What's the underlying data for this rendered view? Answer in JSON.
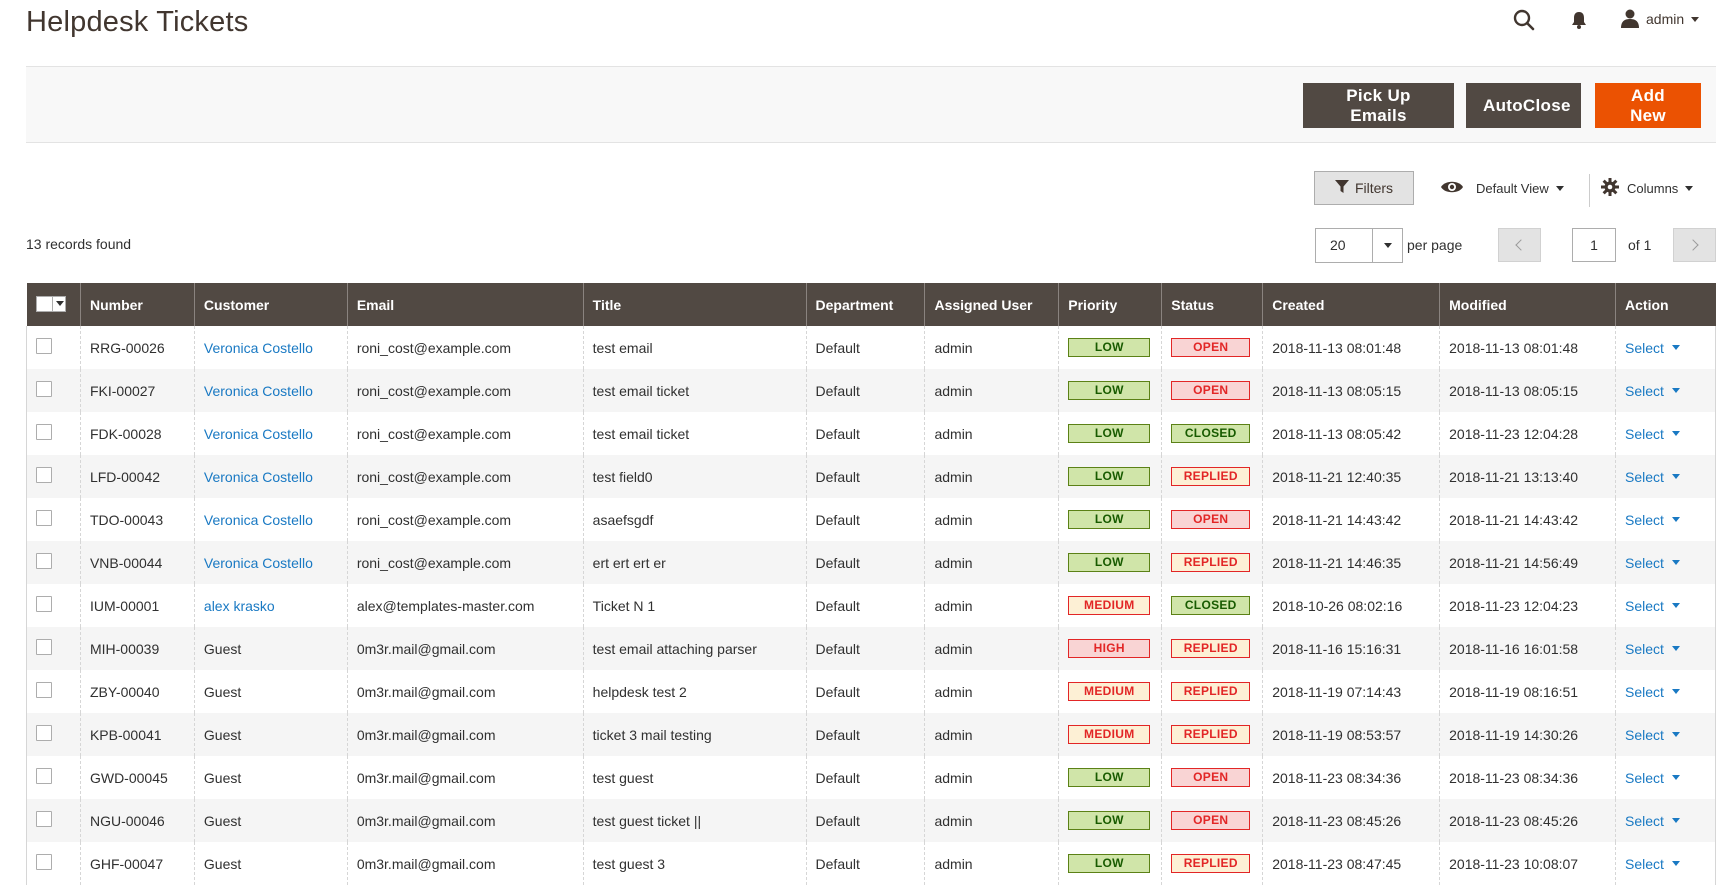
{
  "header": {
    "title": "Helpdesk Tickets",
    "user": "admin"
  },
  "actions": {
    "pick_up": "Pick Up Emails",
    "autoclose": "AutoClose",
    "add_new": "Add New"
  },
  "toolbar": {
    "filters": "Filters",
    "view": "Default View",
    "columns": "Columns"
  },
  "grid_info": {
    "records": "13 records found",
    "per_page_value": "20",
    "per_page_label": "per page",
    "page": "1",
    "of_pages": "of 1"
  },
  "columns": [
    "Number",
    "Customer",
    "Email",
    "Title",
    "Department",
    "Assigned User",
    "Priority",
    "Status",
    "Created",
    "Modified",
    "Action"
  ],
  "rows": [
    {
      "number": "RRG-00026",
      "customer": "Veronica Costello",
      "customer_link": true,
      "email": "roni_cost@example.com",
      "title": "test email",
      "department": "Default",
      "user": "admin",
      "priority": "LOW",
      "status": "OPEN",
      "created": "2018-11-13 08:01:48",
      "modified": "2018-11-13 08:01:48",
      "action": "Select"
    },
    {
      "number": "FKI-00027",
      "customer": "Veronica Costello",
      "customer_link": true,
      "email": "roni_cost@example.com",
      "title": "test email ticket",
      "department": "Default",
      "user": "admin",
      "priority": "LOW",
      "status": "OPEN",
      "created": "2018-11-13 08:05:15",
      "modified": "2018-11-13 08:05:15",
      "action": "Select"
    },
    {
      "number": "FDK-00028",
      "customer": "Veronica Costello",
      "customer_link": true,
      "email": "roni_cost@example.com",
      "title": "test email ticket",
      "department": "Default",
      "user": "admin",
      "priority": "LOW",
      "status": "CLOSED",
      "created": "2018-11-13 08:05:42",
      "modified": "2018-11-23 12:04:28",
      "action": "Select"
    },
    {
      "number": "LFD-00042",
      "customer": "Veronica Costello",
      "customer_link": true,
      "email": "roni_cost@example.com",
      "title": "test field0",
      "department": "Default",
      "user": "admin",
      "priority": "LOW",
      "status": "REPLIED",
      "created": "2018-11-21 12:40:35",
      "modified": "2018-11-21 13:13:40",
      "action": "Select"
    },
    {
      "number": "TDO-00043",
      "customer": "Veronica Costello",
      "customer_link": true,
      "email": "roni_cost@example.com",
      "title": "asaefsgdf",
      "department": "Default",
      "user": "admin",
      "priority": "LOW",
      "status": "OPEN",
      "created": "2018-11-21 14:43:42",
      "modified": "2018-11-21 14:43:42",
      "action": "Select"
    },
    {
      "number": "VNB-00044",
      "customer": "Veronica Costello",
      "customer_link": true,
      "email": "roni_cost@example.com",
      "title": "ert ert ert er",
      "department": "Default",
      "user": "admin",
      "priority": "LOW",
      "status": "REPLIED",
      "created": "2018-11-21 14:46:35",
      "modified": "2018-11-21 14:56:49",
      "action": "Select"
    },
    {
      "number": "IUM-00001",
      "customer": "alex krasko",
      "customer_link": true,
      "email": "alex@templates-master.com",
      "title": "Ticket N 1",
      "department": "Default",
      "user": "admin",
      "priority": "MEDIUM",
      "status": "CLOSED",
      "created": "2018-10-26 08:02:16",
      "modified": "2018-11-23 12:04:23",
      "action": "Select"
    },
    {
      "number": "MIH-00039",
      "customer": "Guest",
      "customer_link": false,
      "email": "0m3r.mail@gmail.com",
      "title": "test email attaching parser",
      "department": "Default",
      "user": "admin",
      "priority": "HIGH",
      "status": "REPLIED",
      "created": "2018-11-16 15:16:31",
      "modified": "2018-11-16 16:01:58",
      "action": "Select"
    },
    {
      "number": "ZBY-00040",
      "customer": "Guest",
      "customer_link": false,
      "email": "0m3r.mail@gmail.com",
      "title": "helpdesk test 2",
      "department": "Default",
      "user": "admin",
      "priority": "MEDIUM",
      "status": "REPLIED",
      "created": "2018-11-19 07:14:43",
      "modified": "2018-11-19 08:16:51",
      "action": "Select"
    },
    {
      "number": "KPB-00041",
      "customer": "Guest",
      "customer_link": false,
      "email": "0m3r.mail@gmail.com",
      "title": "ticket 3 mail testing",
      "department": "Default",
      "user": "admin",
      "priority": "MEDIUM",
      "status": "REPLIED",
      "created": "2018-11-19 08:53:57",
      "modified": "2018-11-19 14:30:26",
      "action": "Select"
    },
    {
      "number": "GWD-00045",
      "customer": "Guest",
      "customer_link": false,
      "email": "0m3r.mail@gmail.com",
      "title": "test guest",
      "department": "Default",
      "user": "admin",
      "priority": "LOW",
      "status": "OPEN",
      "created": "2018-11-23 08:34:36",
      "modified": "2018-11-23 08:34:36",
      "action": "Select"
    },
    {
      "number": "NGU-00046",
      "customer": "Guest",
      "customer_link": false,
      "email": "0m3r.mail@gmail.com",
      "title": "test guest ticket ||",
      "department": "Default",
      "user": "admin",
      "priority": "LOW",
      "status": "OPEN",
      "created": "2018-11-23 08:45:26",
      "modified": "2018-11-23 08:45:26",
      "action": "Select"
    },
    {
      "number": "GHF-00047",
      "customer": "Guest",
      "customer_link": false,
      "email": "0m3r.mail@gmail.com",
      "title": "test guest 3",
      "department": "Default",
      "user": "admin",
      "priority": "LOW",
      "status": "REPLIED",
      "created": "2018-11-23 08:47:45",
      "modified": "2018-11-23 10:08:07",
      "action": "Select"
    }
  ],
  "colors": {
    "header_bg": "#514943",
    "accent_orange": "#eb5202",
    "link_blue": "#1979c3"
  }
}
